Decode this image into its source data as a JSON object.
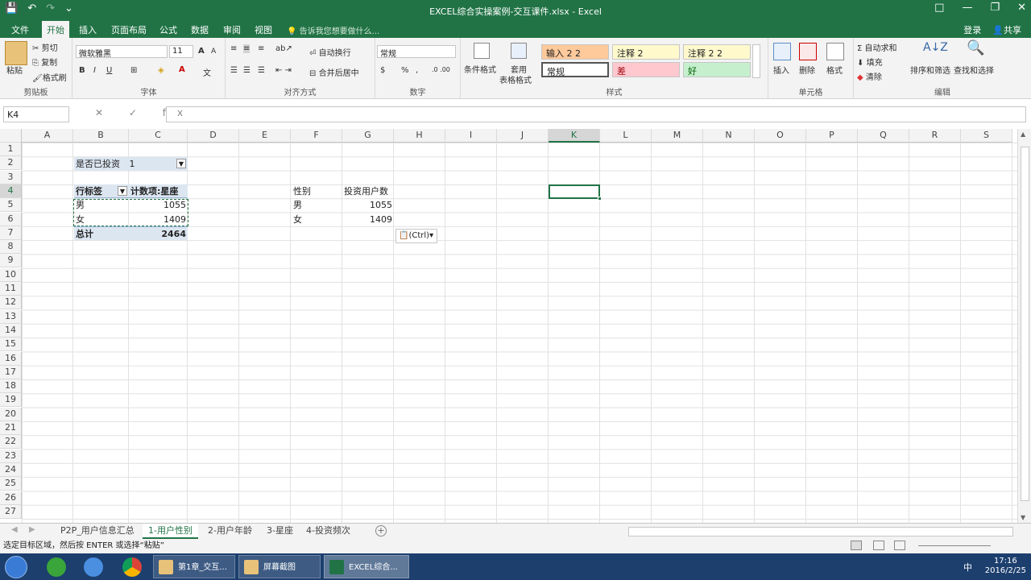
{
  "window": {
    "title": "EXCEL综合实操案例-交互课件.xlsx - Excel",
    "qat": [
      "💾",
      "↶",
      "↷",
      "⌄"
    ],
    "controls": [
      "□",
      "—",
      "❐",
      "✕"
    ]
  },
  "tabs": [
    "文件",
    "开始",
    "插入",
    "页面布局",
    "公式",
    "数据",
    "审阅",
    "视图"
  ],
  "active_tab": "开始",
  "tell_me": "告诉我您想要做什么...",
  "account": {
    "login": "登录",
    "share": "共享"
  },
  "ribbon": {
    "clipboard": {
      "label": "剪贴板",
      "paste": "粘贴",
      "cut": "剪切",
      "copy": "复制",
      "painter": "格式刷"
    },
    "font": {
      "label": "字体",
      "family": "微软雅黑",
      "size": "11",
      "bold": "B",
      "italic": "I",
      "underline": "U",
      "grow": "A",
      "shrink": "A",
      "wen": "文"
    },
    "alignment": {
      "label": "对齐方式",
      "wrap": "自动换行",
      "merge": "合并后居中"
    },
    "number": {
      "label": "数字",
      "format": "常规",
      "percent": "%",
      "comma": ","
    },
    "styles": {
      "label": "样式",
      "cond": "条件格式",
      "table1": "套用",
      "table2": "表格格式",
      "cells": [
        "输入 2 2",
        "注释 2",
        "注释 2 2",
        "常规",
        "差",
        "好"
      ]
    },
    "cells": {
      "label": "单元格",
      "insert": "插入",
      "delete": "删除",
      "format": "格式"
    },
    "editing": {
      "label": "编辑",
      "autosum": "自动求和",
      "fill": "填充",
      "clear": "清除",
      "sort": "排序和筛选",
      "find": "查找和选择"
    }
  },
  "formula_bar": {
    "name_box": "K4",
    "fx": "✕ ✓ fx",
    "value": ""
  },
  "columns": [
    "A",
    "B",
    "C",
    "D",
    "E",
    "F",
    "G",
    "H",
    "I",
    "J",
    "K",
    "L",
    "M",
    "N",
    "O",
    "P",
    "Q",
    "R",
    "S"
  ],
  "rows": [
    "1",
    "2",
    "3",
    "4",
    "5",
    "6",
    "7",
    "8",
    "9",
    "10",
    "11",
    "12",
    "13",
    "14",
    "15",
    "16",
    "17",
    "18",
    "19",
    "20",
    "21",
    "22",
    "23",
    "24",
    "25",
    "26",
    "27"
  ],
  "selected": {
    "col": "K",
    "row": "4"
  },
  "pivot": {
    "filter_label": "是否已投资",
    "filter_value": "1",
    "row_label": "行标签",
    "count_label": "计数项:星座",
    "rows": [
      {
        "k": "男",
        "v": "1055"
      },
      {
        "k": "女",
        "v": "1409"
      }
    ],
    "total_label": "总计",
    "total": "2464"
  },
  "table2": {
    "h1": "性别",
    "h2": "投资用户数",
    "rows": [
      {
        "k": "男",
        "v": "1055"
      },
      {
        "k": "女",
        "v": "1409"
      }
    ]
  },
  "paste_options": "(Ctrl)",
  "sheets": [
    "P2P_用户信息汇总",
    "1-用户性别",
    "2-用户年龄",
    "3-星座",
    "4-投资频次"
  ],
  "active_sheet": "1-用户性别",
  "status_text": "选定目标区域，然后按 ENTER 或选择“粘贴”",
  "taskbar": {
    "items": [
      "第1章_交互...",
      "屏幕截图",
      "EXCEL综合..."
    ],
    "time": "17:16",
    "date": "2016/2/25",
    "ime": "中"
  }
}
